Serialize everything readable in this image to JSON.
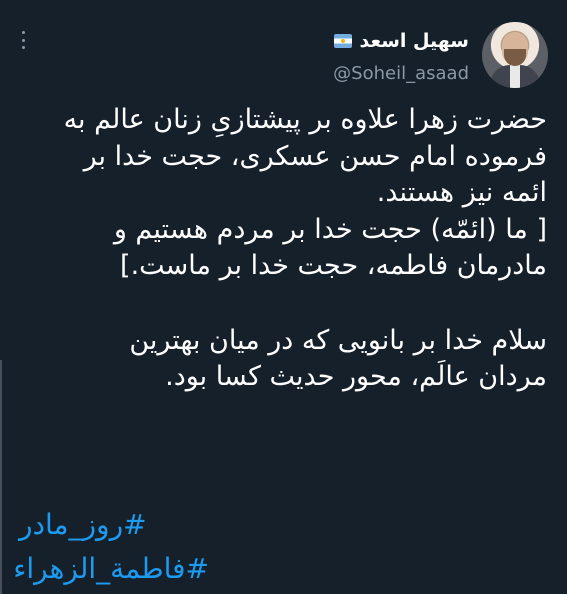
{
  "header": {
    "display_name": "سهیل اسعد",
    "handle": "@Soheil_asaad"
  },
  "tweet": {
    "paragraph1": [
      "حضرت زهرا علاوه بر پیشتازیِ زنان عالم به",
      "فرموده امام حسن عسکری، حجت خدا بر",
      "ائمه نیز هستند.",
      "[ ما (ائمّه) حجت خدا بر مردم هستیم و",
      "مادرمان فاطمه، حجت خدا بر ماست.]"
    ],
    "paragraph2": [
      "سلام خدا بر بانویی که در میان بهترین",
      "مردان عالَم، محور حدیث کسا بود."
    ],
    "hashtags": [
      "#روز_مادر",
      "#فاطمة_الزهراء"
    ]
  },
  "colors": {
    "background": "#15202b",
    "text": "#ffffff",
    "secondary": "#8b98a5",
    "link": "#1d9bf0"
  },
  "icons": {
    "menu": "more-icon",
    "verification_flag": "argentina-flag-icon"
  }
}
